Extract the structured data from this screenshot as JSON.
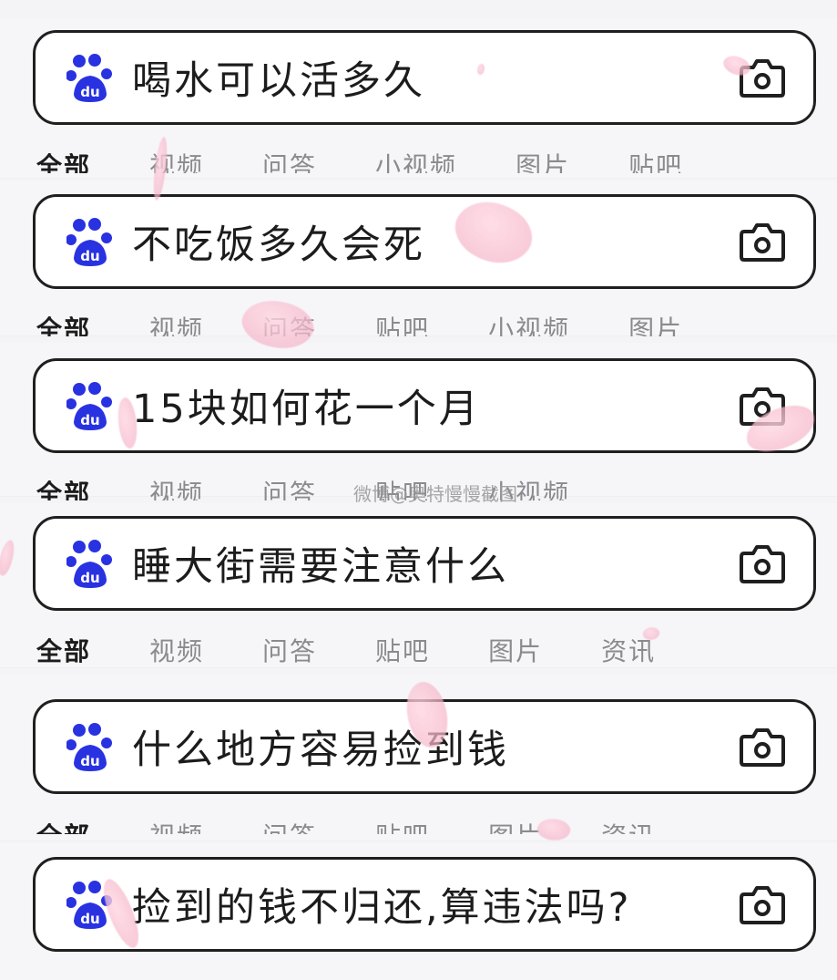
{
  "rows": [
    {
      "query": "喝水可以活多久",
      "tabs": [
        "全部",
        "视频",
        "问答",
        "小视频",
        "图片",
        "贴吧"
      ]
    },
    {
      "query": "不吃饭多久会死",
      "tabs": [
        "全部",
        "视频",
        "问答",
        "贴吧",
        "小视频",
        "图片"
      ]
    },
    {
      "query": "15块如何花一个月",
      "tabs": [
        "全部",
        "视频",
        "问答",
        "贴吧",
        "小视频"
      ]
    },
    {
      "query": "睡大街需要注意什么",
      "tabs": [
        "全部",
        "视频",
        "问答",
        "贴吧",
        "图片",
        "资讯"
      ]
    },
    {
      "query": "什么地方容易捡到钱",
      "tabs": [
        "全部",
        "视频",
        "问答",
        "贴吧",
        "图片",
        "资讯"
      ]
    },
    {
      "query": "捡到的钱不归还,算违法吗?",
      "tabs": []
    }
  ],
  "watermark": "微博@奥特慢慢截图",
  "icons": {
    "logo": "baidu-paw-du-icon",
    "camera": "camera-icon"
  },
  "colors": {
    "brand_blue": "#2932e1",
    "border": "#1f1f1f",
    "petal": "#f3b3c6"
  }
}
